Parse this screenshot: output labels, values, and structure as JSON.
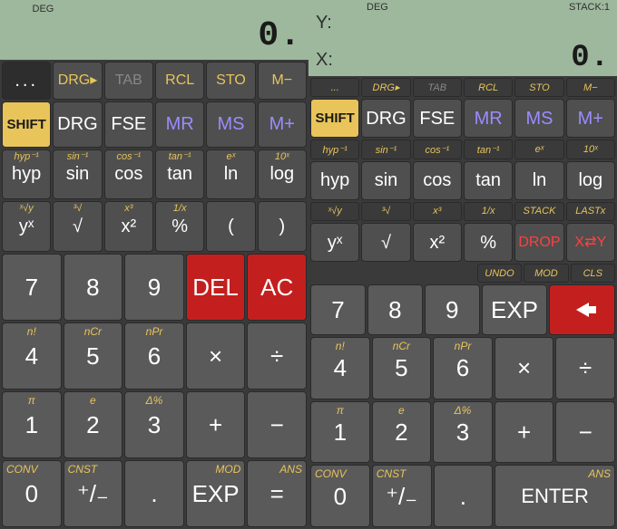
{
  "left": {
    "display": {
      "status_deg": "DEG",
      "value": "0."
    },
    "row1_sup": [
      "...",
      "DRG▸",
      "TAB",
      "RCL",
      "STO",
      "M−"
    ],
    "row1": [
      "SHIFT",
      "DRG",
      "FSE",
      "MR",
      "MS",
      "M+"
    ],
    "row2_sup": [
      "hyp⁻¹",
      "sin⁻¹",
      "cos⁻¹",
      "tan⁻¹",
      "eˣ",
      "10ˣ"
    ],
    "row2": [
      "hyp",
      "sin",
      "cos",
      "tan",
      "ln",
      "log"
    ],
    "row3_sup": [
      "ˣ√y",
      "³√",
      "x³",
      "1/x",
      "",
      ""
    ],
    "row3": [
      "yˣ",
      "√",
      "x²",
      "%",
      "(",
      ")"
    ],
    "row4": [
      "7",
      "8",
      "9",
      "DEL",
      "AC"
    ],
    "row5_sup": [
      "n!",
      "nCr",
      "nPr",
      "",
      ""
    ],
    "row5": [
      "4",
      "5",
      "6",
      "×",
      "÷"
    ],
    "row6_sup": [
      "π",
      "e",
      "Δ%",
      "",
      ""
    ],
    "row6": [
      "1",
      "2",
      "3",
      "+",
      "−"
    ],
    "row7_sup": [
      "CONV",
      "CNST",
      "",
      "MOD",
      "ANS"
    ],
    "row7": [
      "0",
      "⁺/₋",
      ".",
      "EXP",
      "="
    ]
  },
  "right": {
    "display": {
      "status_deg": "DEG",
      "status_stack": "STACK:1",
      "y_label": "Y:",
      "y_value": "",
      "x_label": "X:",
      "x_value": "0."
    },
    "srow1": [
      "...",
      "DRG▸",
      "TAB",
      "RCL",
      "STO",
      "M−"
    ],
    "row1": [
      "SHIFT",
      "DRG",
      "FSE",
      "MR",
      "MS",
      "M+"
    ],
    "srow2": [
      "hyp⁻¹",
      "sin⁻¹",
      "cos⁻¹",
      "tan⁻¹",
      "eˣ",
      "10ˣ"
    ],
    "row2": [
      "hyp",
      "sin",
      "cos",
      "tan",
      "ln",
      "log"
    ],
    "srow3": [
      "ˣ√y",
      "³√",
      "x³",
      "1/x",
      "STACK",
      "LASTx"
    ],
    "row3": [
      "yˣ",
      "√",
      "x²",
      "%",
      "DROP",
      "X⇄Y"
    ],
    "srow4": [
      "",
      "",
      "",
      "UNDO",
      "MOD",
      "CLS"
    ],
    "row4": [
      "7",
      "8",
      "9",
      "EXP",
      "←"
    ],
    "row5_sup": [
      "n!",
      "nCr",
      "nPr",
      "",
      ""
    ],
    "row5": [
      "4",
      "5",
      "6",
      "×",
      "÷"
    ],
    "row6_sup": [
      "π",
      "e",
      "Δ%",
      "",
      ""
    ],
    "row6": [
      "1",
      "2",
      "3",
      "+",
      "−"
    ],
    "row7_sup": [
      "CONV",
      "CNST",
      "",
      "",
      "ANS"
    ],
    "row7": [
      "0",
      "⁺/₋",
      ".",
      "",
      "ENTER"
    ]
  }
}
